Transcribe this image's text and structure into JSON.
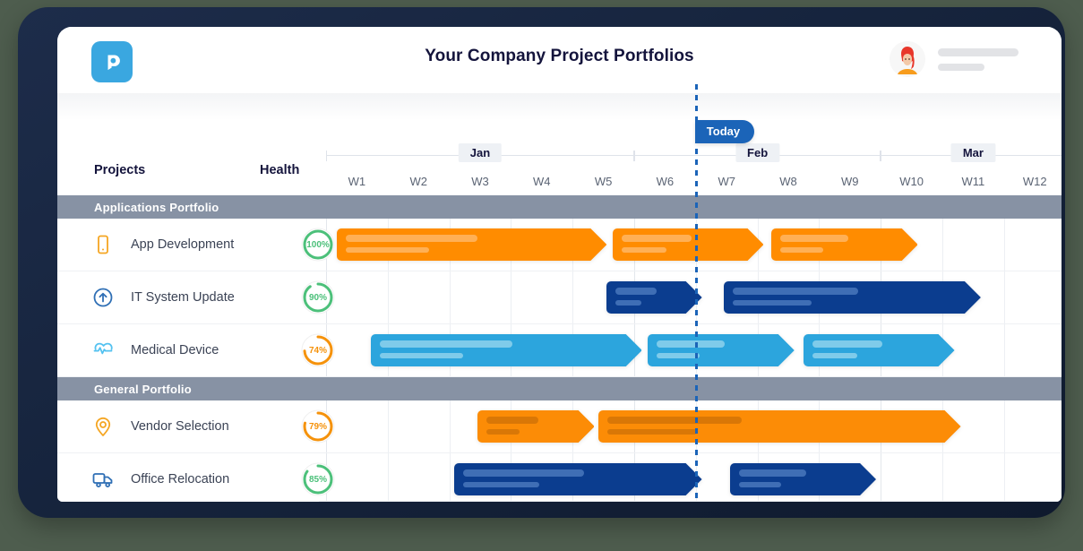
{
  "header": {
    "title": "Your Company Project Portfolios",
    "logo_glyph": "p",
    "logo_color": "#3aa7e0"
  },
  "table": {
    "col_projects": "Projects",
    "col_health": "Health"
  },
  "timeline": {
    "today_label": "Today",
    "today_week_index": 6,
    "months": [
      {
        "label": "Jan",
        "start": 0,
        "span": 5
      },
      {
        "label": "Feb",
        "start": 5,
        "span": 4
      },
      {
        "label": "Mar",
        "start": 9,
        "span": 3
      }
    ],
    "weeks": [
      "W1",
      "W2",
      "W3",
      "W4",
      "W5",
      "W6",
      "W7",
      "W8",
      "W9",
      "W10",
      "W11",
      "W12"
    ]
  },
  "groups": [
    {
      "name": "Applications Portfolio",
      "projects": [
        {
          "name": "App Development",
          "icon": "phone-icon",
          "icon_color": "#f5a623",
          "health": "100%",
          "health_value": 100,
          "health_color": "#4cc07a",
          "bar_color": "#ff8c00",
          "bar_line_color": "#ffb055",
          "bars": [
            {
              "start": 0.17,
              "end": 4.55
            },
            {
              "start": 4.65,
              "end": 7.1
            },
            {
              "start": 7.22,
              "end": 9.6
            }
          ]
        },
        {
          "name": "IT System Update",
          "icon": "arrow-up-circle-icon",
          "icon_color": "#2f6fb5",
          "health": "90%",
          "health_value": 90,
          "health_color": "#4cc07a",
          "bar_color": "#0b3d8f",
          "bar_line_color": "#3f6eb5",
          "bars": [
            {
              "start": 4.55,
              "end": 6.1
            },
            {
              "start": 6.45,
              "end": 10.62
            }
          ]
        },
        {
          "name": "Medical Device",
          "icon": "heartbeat-icon",
          "icon_color": "#54c2f0",
          "health": "74%",
          "health_value": 74,
          "health_color": "#f5920b",
          "bar_color": "#2ca5dd",
          "bar_line_color": "#7fcbea",
          "bars": [
            {
              "start": 0.72,
              "end": 5.12
            },
            {
              "start": 5.22,
              "end": 7.6
            },
            {
              "start": 7.75,
              "end": 10.2
            }
          ]
        }
      ]
    },
    {
      "name": "General Portfolio",
      "projects": [
        {
          "name": "Vendor Selection",
          "icon": "map-pin-icon",
          "icon_color": "#f5a623",
          "health": "79%",
          "health_value": 79,
          "health_color": "#f5920b",
          "bar_color": "#fc8c06",
          "bar_line_color": "#d97706",
          "bars": [
            {
              "start": 2.45,
              "end": 4.35
            },
            {
              "start": 4.42,
              "end": 10.3
            }
          ]
        },
        {
          "name": "Office Relocation",
          "icon": "truck-icon",
          "icon_color": "#2f6fb5",
          "health": "85%",
          "health_value": 85,
          "health_color": "#4cc07a",
          "bar_color": "#0b3d8f",
          "bar_line_color": "#3f6eb5",
          "bars": [
            {
              "start": 2.08,
              "end": 6.1
            },
            {
              "start": 6.55,
              "end": 8.92
            }
          ]
        }
      ]
    }
  ]
}
